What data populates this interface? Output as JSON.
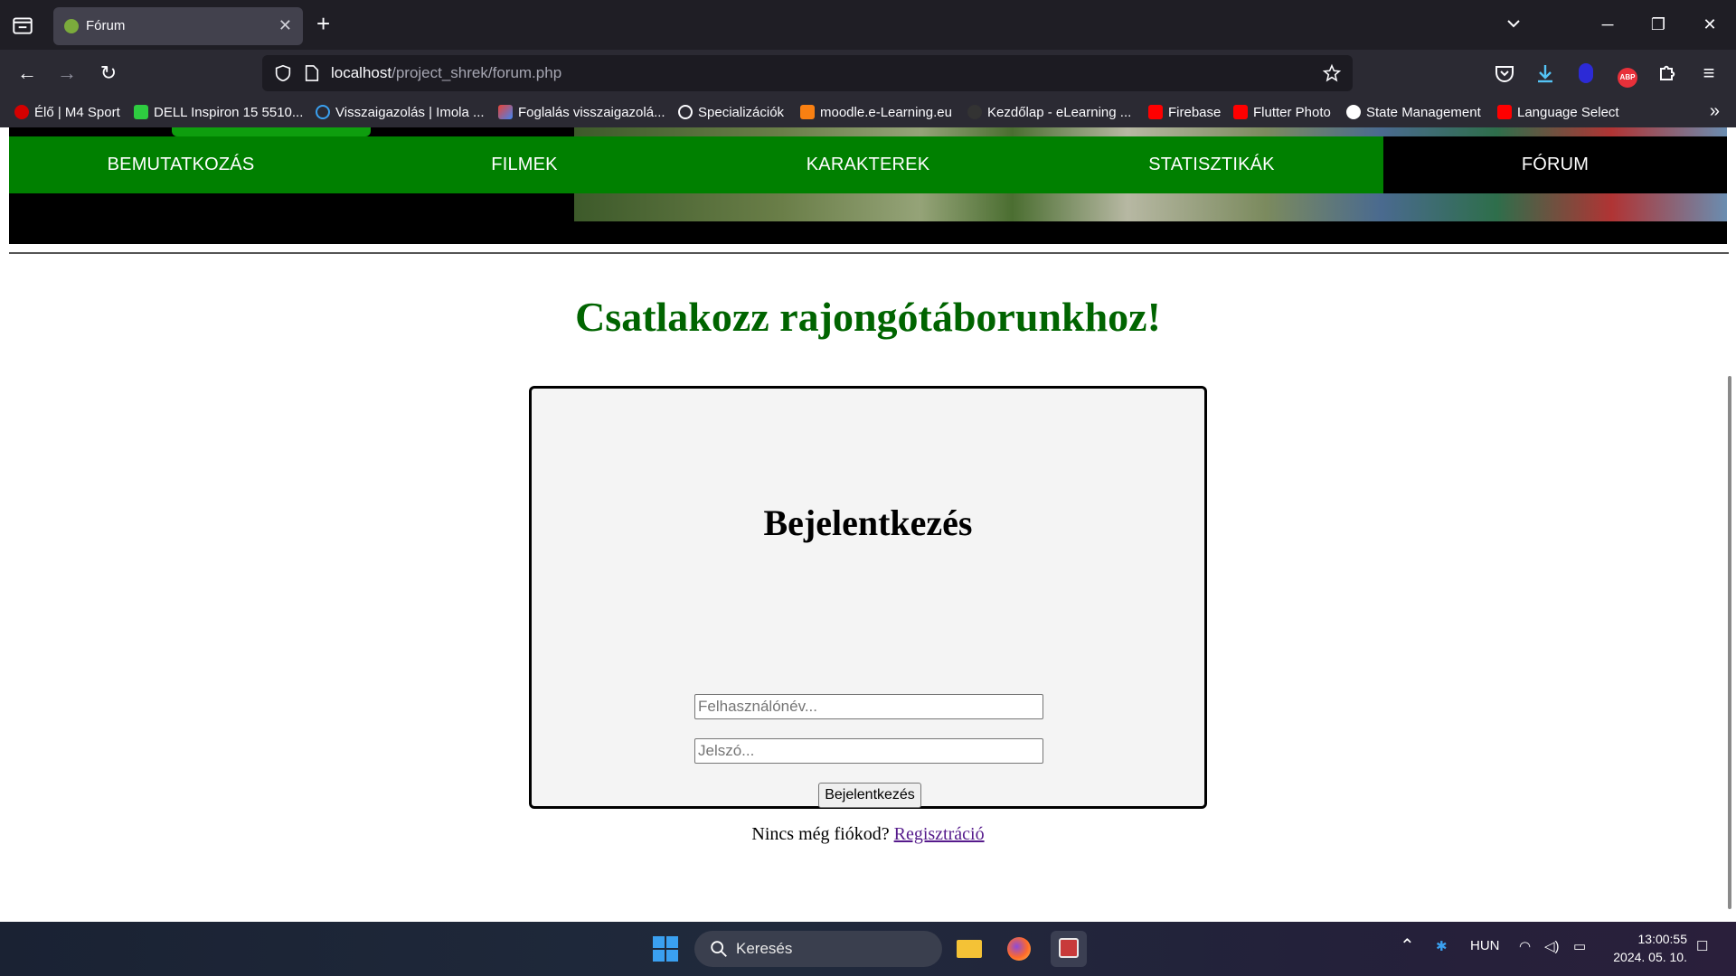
{
  "browser": {
    "tab": {
      "title": "Fórum"
    },
    "url": {
      "host": "localhost",
      "path": "/project_shrek/forum.php"
    },
    "bookmarks": [
      {
        "label": "Élő | M4 Sport",
        "color": "#d40000"
      },
      {
        "label": "DELL Inspiron 15 5510...",
        "color": "#2ecc40"
      },
      {
        "label": "Visszaigazolás | Imola ...",
        "color": "#3aa0f0"
      },
      {
        "label": "Foglalás visszaigazolá...",
        "color": "#ea4335"
      },
      {
        "label": "Specializációk",
        "color": "#ffffff"
      },
      {
        "label": "moodle.e-Learning.eu",
        "color": "#f98012"
      },
      {
        "label": "Kezdőlap - eLearning ...",
        "color": "#333333"
      },
      {
        "label": "Firebase",
        "color": "#ff0000"
      },
      {
        "label": "Flutter Photo",
        "color": "#ff0000"
      },
      {
        "label": "State Management",
        "color": "#ffffff"
      },
      {
        "label": "Language Select",
        "color": "#ff0000"
      }
    ]
  },
  "site": {
    "menu": [
      {
        "label": "BEMUTATKOZÁS",
        "active": false
      },
      {
        "label": "FILMEK",
        "active": false
      },
      {
        "label": "KARAKTEREK",
        "active": false
      },
      {
        "label": "STATISZTIKÁK",
        "active": false
      },
      {
        "label": "FÓRUM",
        "active": true
      }
    ],
    "heading": "Csatlakozz rajongótáborunkhoz!",
    "login": {
      "title": "Bejelentkezés",
      "username_placeholder": "Felhasználónév...",
      "password_placeholder": "Jelszó...",
      "submit_label": "Bejelentkezés",
      "no_account_text": "Nincs még fiókod?",
      "register_link": "Regisztráció"
    }
  },
  "taskbar": {
    "search_placeholder": "Keresés",
    "language": "HUN",
    "time": "13:00:55",
    "date": "2024. 05. 10."
  },
  "colors": {
    "menu_green": "#008000",
    "heading_green": "#006400",
    "link_purple": "#551a8b"
  }
}
